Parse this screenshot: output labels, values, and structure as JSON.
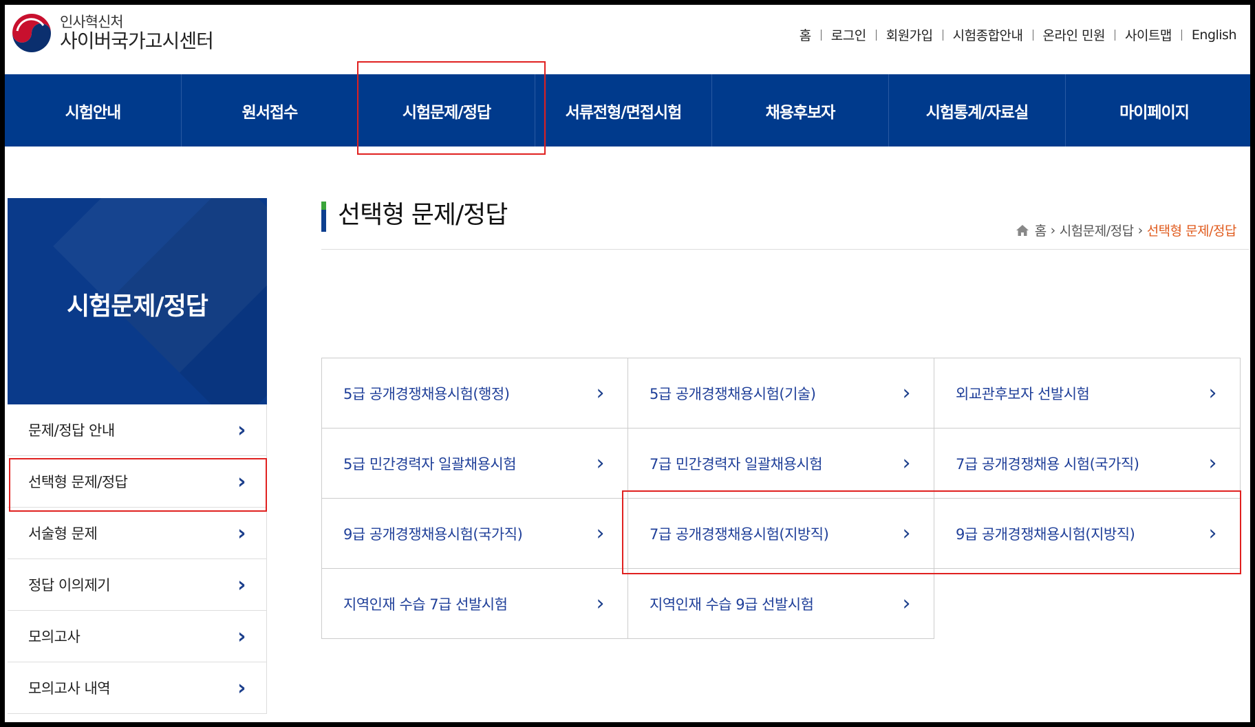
{
  "header": {
    "logo_small": "인사혁신처",
    "logo_big": "사이버국가고시센터",
    "util_nav": [
      "홈",
      "로그인",
      "회원가입",
      "시험종합안내",
      "온라인 민원",
      "사이트맵",
      "English"
    ]
  },
  "gnb": [
    "시험안내",
    "원서접수",
    "시험문제/정답",
    "서류전형/면접시험",
    "채용후보자",
    "시험통계/자료실",
    "마이페이지"
  ],
  "sidebar": {
    "title": "시험문제/정답",
    "items": [
      "문제/정답 안내",
      "선택형 문제/정답",
      "서술형 문제",
      "정답 이의제기",
      "모의고사",
      "모의고사 내역"
    ]
  },
  "content": {
    "title": "선택형 문제/정답",
    "breadcrumb": [
      "홈",
      "시험문제/정답",
      "선택형 문제/정답"
    ],
    "exams": [
      [
        "5급 공개경쟁채용시험(행정)",
        "5급 공개경쟁채용시험(기술)",
        "외교관후보자 선발시험"
      ],
      [
        "5급 민간경력자 일괄채용시험",
        "7급 민간경력자 일괄채용시험",
        "7급 공개경쟁채용 시험(국가직)"
      ],
      [
        "9급 공개경쟁채용시험(국가직)",
        "7급 공개경쟁채용시험(지방직)",
        "9급 공개경쟁채용시험(지방직)"
      ],
      [
        "지역인재 수습 7급 선발시험",
        "지역인재 수습 9급 선발시험"
      ]
    ]
  },
  "colors": {
    "navy": "#003a8c",
    "highlight_red": "#e0201f",
    "breadcrumb_current": "#e05a1c",
    "link_blue": "#1f3f99"
  }
}
